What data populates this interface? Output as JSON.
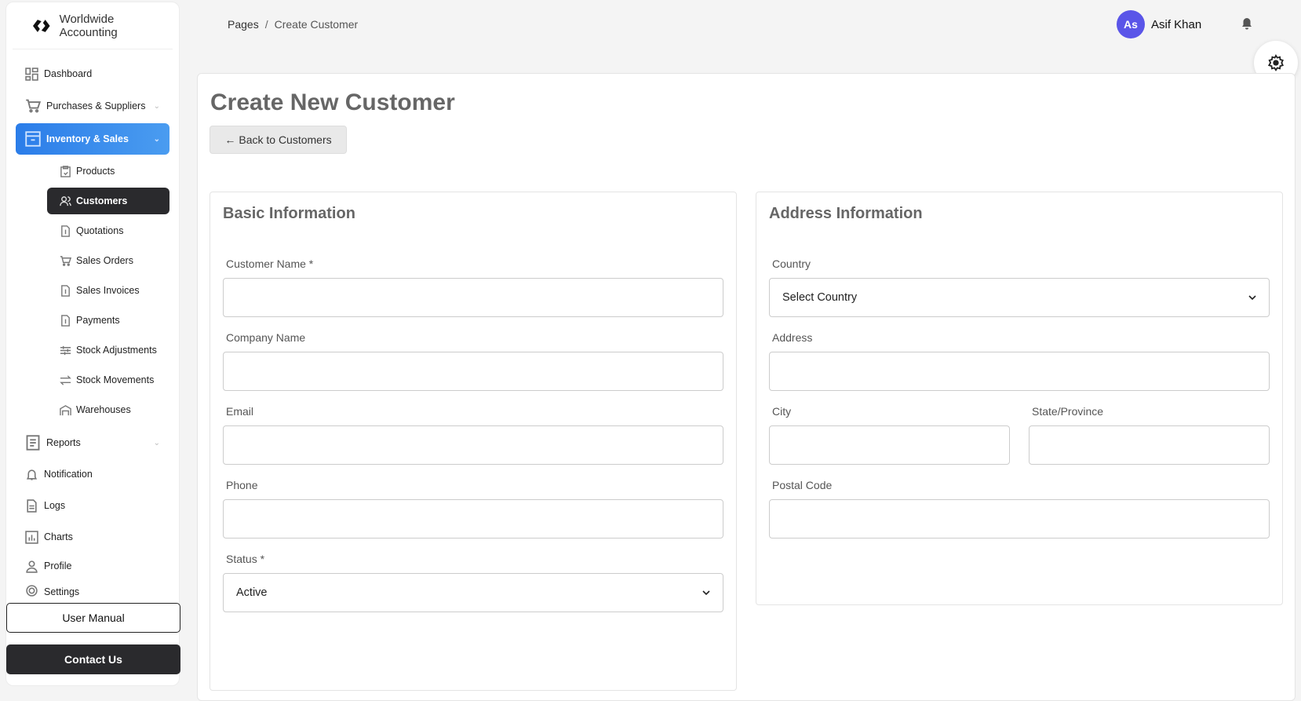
{
  "brand": {
    "name": "Worldwide Accounting"
  },
  "sidebar": {
    "items": [
      {
        "label": "Dashboard",
        "icon": "dashboard-icon"
      },
      {
        "label": "Purchases & Suppliers",
        "icon": "cart-icon"
      },
      {
        "label": "Inventory & Sales",
        "icon": "archive-icon"
      }
    ],
    "subitems": [
      {
        "label": "Products"
      },
      {
        "label": "Customers"
      },
      {
        "label": "Quotations"
      },
      {
        "label": "Sales Orders"
      },
      {
        "label": "Sales Invoices"
      },
      {
        "label": "Payments"
      },
      {
        "label": "Stock Adjustments"
      },
      {
        "label": "Stock Movements"
      },
      {
        "label": "Warehouses"
      }
    ],
    "bottom_items": [
      {
        "label": "Reports"
      },
      {
        "label": "Notification"
      },
      {
        "label": "Logs"
      },
      {
        "label": "Charts"
      },
      {
        "label": "Profile"
      },
      {
        "label": "Settings"
      }
    ],
    "user_manual": "User Manual",
    "contact_us": "Contact Us",
    "accent": "#2b7de9"
  },
  "header": {
    "breadcrumb": [
      "Pages",
      "Create Customer"
    ],
    "user": {
      "initials": "As",
      "name": "Asif Khan"
    }
  },
  "main": {
    "title": "Create New Customer",
    "back_label": "Back to Customers",
    "basic": {
      "title": "Basic Information",
      "customer_name": {
        "label": "Customer Name *",
        "value": ""
      },
      "company_name": {
        "label": "Company Name",
        "value": ""
      },
      "email": {
        "label": "Email",
        "value": ""
      },
      "phone": {
        "label": "Phone",
        "value": ""
      },
      "status": {
        "label": "Status *",
        "value": "Active"
      }
    },
    "address": {
      "title": "Address Information",
      "country": {
        "label": "Country",
        "value": "Select Country"
      },
      "address": {
        "label": "Address",
        "value": ""
      },
      "city": {
        "label": "City",
        "value": ""
      },
      "state": {
        "label": "State/Province",
        "value": ""
      },
      "postal": {
        "label": "Postal Code",
        "value": ""
      }
    }
  }
}
